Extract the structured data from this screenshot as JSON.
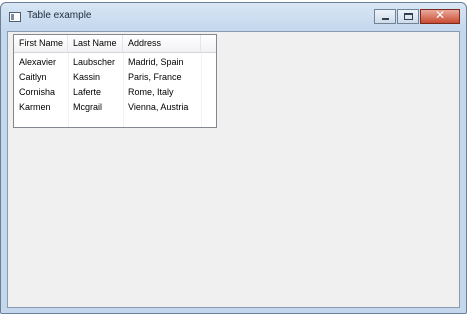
{
  "window": {
    "title": "Table example"
  },
  "table": {
    "columns": [
      "First Name",
      "Last Name",
      "Address"
    ],
    "rows": [
      [
        "Alexavier",
        "Laubscher",
        "Madrid, Spain"
      ],
      [
        "Caitlyn",
        "Kassin",
        "Paris, France"
      ],
      [
        "Cornisha",
        "Laferte",
        "Rome, Italy"
      ],
      [
        "Karmen",
        "Mcgrail",
        "Vienna, Austria"
      ]
    ]
  },
  "colors": {
    "titlebar": "#c4d7ed",
    "close_button": "#c94a32",
    "client_background": "#f0f0f0"
  }
}
